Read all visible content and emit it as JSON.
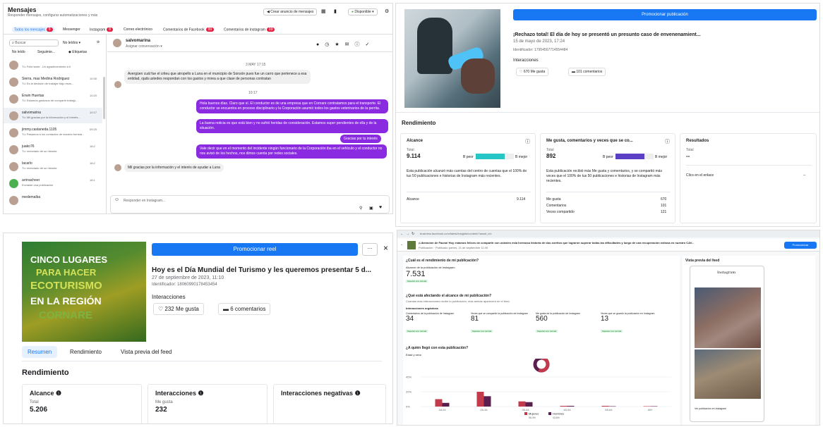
{
  "inbox": {
    "title": "Mensajes",
    "subtitle": "Responder mensajes, configurar automatizaciones y más",
    "create_ad": "Crear anuncio de mensajes",
    "status": "Disponible",
    "tabs": [
      {
        "label": "Todos los mensajes",
        "count": "8"
      },
      {
        "label": "Messenger",
        "count": ""
      },
      {
        "label": "Instagram",
        "count": "8"
      },
      {
        "label": "Correo electrónico",
        "count": ""
      },
      {
        "label": "Comentarios de Facebook",
        "count": "99"
      },
      {
        "label": "Comentarios de Instagram",
        "count": "99"
      }
    ],
    "search_placeholder": "Buscar",
    "filter_unread": "No leídos",
    "filter_read": "No leído",
    "filter_follow": "Seguimie...",
    "filter_tags": "Etiquetas",
    "conversations": [
      {
        "name": "",
        "snippet": "Tú: Feliz tarde . Un agradecimiento a ti",
        "time": ""
      },
      {
        "name": "Sierra, mas Medina Rodriguez",
        "snippet": "Tú: Es la decisión de trabajar bajo esos...",
        "time": "10:30"
      },
      {
        "name": "Erwin Huertas",
        "snippet": "Tú: Estamos gustosos de compartir trabajo...",
        "time": "10:20"
      },
      {
        "name": "salvomarina",
        "snippet": "Tú: Mil gracias por la información y el interés...",
        "time": "10:17"
      },
      {
        "name": "jimmy.castaneda.1105",
        "snippet": "Tú: Pasamos a los contactos de manera fornida...",
        "time": "09:25"
      },
      {
        "name": "juako76",
        "snippet": "Tú: reenviado de su historia",
        "time": "18:2"
      },
      {
        "name": "lacarlo",
        "snippet": "Tú: reenviado de su historia",
        "time": "18:2"
      },
      {
        "name": "arrinacheer",
        "snippet": "Enviaste una publicación",
        "time": "18:1"
      },
      {
        "name": "medemalba",
        "snippet": "",
        "time": ""
      }
    ],
    "chat_name": "salvomarina",
    "chat_sub": "Asignar conversación",
    "day_label": "3 MAY 17:15",
    "time_label": "10:17",
    "messages": [
      {
        "dir": "in",
        "text": "Avergüen cuál fue el criteu que atropello a Luna en el municipio de Sonsón pues fue un carro que pertenece a esa entidad, ojalá ustedes respondan con los gastos y mirea a que clase de personas contratan"
      },
      {
        "dir": "out",
        "text": "Hola buenos días. Claro que sí. El conductor es de una empresa que en Cornare contratamos para el transporte. El conductor se encuentra en proceso disciplinario y la Corporación asumió todos los gastos veterinarios de la perrita."
      },
      {
        "dir": "out",
        "text": "La buena noticia es que está bien y no sufrió heridas de consideración. Estamos super pendientes de ella y de la situación."
      },
      {
        "dir": "out",
        "text": "Gracias por tu interés"
      },
      {
        "dir": "out",
        "text": "Vale decir que en el momento del incidente ningún funcionario de la Corporación iba en el vehículo y el conductor no nos avisó de los hechos, nos dimos cuenta por redes sociales."
      },
      {
        "dir": "in",
        "text": "Mil gracias por la información y el interés de ayudar a Luna"
      }
    ],
    "reply_placeholder": "Responder en Instagram..."
  },
  "post1": {
    "promote": "Promocionar publicación",
    "title": "¡Rechazo total! El día de hoy se presentó un presunto caso de envenenamient...",
    "date": "15 de mayo de 2023, 17:24",
    "id": "Identificador: 17954567714554484",
    "interactions_label": "Interacciones",
    "likes": "670 Me gusta",
    "comments": "101 comentarios",
    "rendimiento": "Rendimiento",
    "card1": {
      "title": "Alcance",
      "total_label": "Total",
      "total": "9.114",
      "worse": "B peor",
      "better": "B mejor",
      "desc": "Esta publicación alcanzó más cuentas del centro de cuentas que el 100% de tus 50 publicaciones e historias de Instagram más recientes.",
      "row_label": "Alcance",
      "row_value": "9.114",
      "bar_fill": 0.75
    },
    "card2": {
      "title": "Me gusta, comentarios y veces que se co...",
      "total_label": "Total",
      "total": "892",
      "worse": "B peor",
      "better": "B mejor",
      "desc": "Esta publicación recibió más Me gusta y comentarios, y se compartió más veces que el 100% de tus 50 publicaciones e historias de Instagram más recientes.",
      "rows": [
        {
          "label": "Me gusta",
          "value": "670"
        },
        {
          "label": "Comentarios",
          "value": "101"
        },
        {
          "label": "Veces compartido",
          "value": "121"
        }
      ],
      "bar_fill": 0.75
    },
    "card3": {
      "title": "Resultados",
      "total_label": "Total",
      "total": "--",
      "row_label": "Clics en el enlace",
      "row_value": "--"
    }
  },
  "reel": {
    "image_lines": [
      "CINCO LUGARES",
      "PARA HACER",
      "ECOTURISMO",
      "EN LA REGIÓN",
      "CORNARE"
    ],
    "promote": "Promocionar reel",
    "more": "...",
    "close": "×",
    "title": "Hoy es el Día Mundial del Turismo y les queremos presentar 5 d...",
    "date": "27 de septiembre de 2023, 11:10",
    "id": "Identificador: 18060990178453454",
    "interactions_label": "Interacciones",
    "likes": "232 Me gusta",
    "comments": "6 comentarios",
    "tabs": [
      "Resumen",
      "Rendimiento",
      "Vista previa del feed"
    ],
    "rendimiento": "Rendimiento",
    "cards": [
      {
        "title": "Alcance",
        "sub": "Total",
        "value": "5.206"
      },
      {
        "title": "Interacciones",
        "sub": "Me gusta",
        "value": "232"
      },
      {
        "title": "Interacciones negativas",
        "sub": "",
        "value": ""
      }
    ]
  },
  "insights": {
    "url": "business.facebook.com/latest/insights/content/?asset_id=",
    "post_title": "¡Liberación de Fauna! Hoy estamos felices de compartir con ustedes esta hermosa historia de dos zorritos que lograron superar todas las dificultades y luego de una recuperación exitosa en nuestro CAV...",
    "post_meta": "Publicación · Publicado jueves, 21 de septiembre 11:00",
    "promote": "Promocionar",
    "q1": "¿Cuál es el rendimiento de mi publicación?",
    "reach_label": "Alcance de la publicación de Instagram",
    "reach": "7.531",
    "reach_tag": "Superior a lo normal",
    "q2": "¿Qué está afectando el alcance de mi publicación?",
    "q2_sub": "Cuantas más interacciones recibe tu publicación, más ambas aparecerá en el feed.",
    "organic": "Interacciones orgánicas",
    "metrics": [
      {
        "label": "Comentarios de la publicación de Instagram",
        "value": "34",
        "tag": "Superior a lo normal"
      },
      {
        "label": "Veces que se compartió la publicación de Instagram",
        "value": "81",
        "tag": "Superior a lo normal"
      },
      {
        "label": "Me gusta de la publicación de Instagram",
        "value": "560",
        "tag": "Superior a lo normal"
      },
      {
        "label": "Veces que se guardó la publicación en Instagram",
        "value": "13",
        "tag": "Superior a lo normal"
      }
    ],
    "q3": "¿A quién llegó con esta publicación?",
    "age_label": "Edad y sexo",
    "preview_title": "Vista previa del feed",
    "phone_brand": "Instagram",
    "view_link": "Ver publicación en Instagram"
  },
  "chart_data": {
    "type": "bar",
    "categories": [
      "18-24",
      "25-34",
      "35-44",
      "45-54",
      "55-64",
      "65+"
    ],
    "ylim": [
      0,
      40
    ],
    "yticks": [
      "40%",
      "20%",
      "0%"
    ],
    "series": [
      {
        "name": "Mujeres",
        "values": [
          10,
          20,
          7,
          1,
          1,
          0.5
        ],
        "color": "#c23a4b"
      },
      {
        "name": "Hombres",
        "values": [
          5,
          14,
          6,
          1,
          0.5,
          0.5
        ],
        "color": "#5a1e4f"
      }
    ],
    "legend": [
      {
        "name": "Mujeres",
        "pct": "56,4%"
      },
      {
        "name": "Hombres",
        "pct": "43,6%"
      }
    ],
    "donut_fraction": 0.564
  }
}
